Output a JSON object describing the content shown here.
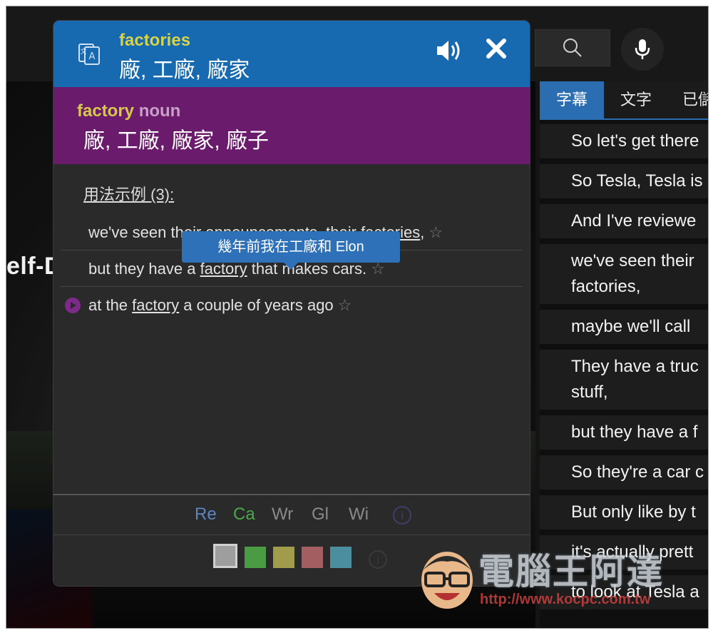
{
  "popup": {
    "headword": "factories",
    "translation": "廠, 工廠, 廠家",
    "pos_word": "factory",
    "pos_label": "noun",
    "pos_translation": "廠, 工廠, 廠家, 廠子",
    "examples_title": "用法示例 (3):",
    "examples": [
      {
        "pre": "we've seen their announcements, their ",
        "word": "factories",
        "post": ","
      },
      {
        "pre": "but they have a ",
        "word": "factory",
        "post": " that makes cars."
      },
      {
        "pre": "at the ",
        "word": "factory",
        "post": " a couple of years ago"
      }
    ],
    "star": "☆",
    "tooltip": "幾年前我在工廠和 Elon",
    "sources": [
      {
        "label": "Re",
        "color": "#5b86c2"
      },
      {
        "label": "Ca",
        "color": "#4aa84a"
      },
      {
        "label": "Wr",
        "color": "#8a8a8a"
      },
      {
        "label": "Gl",
        "color": "#8a8a8a"
      },
      {
        "label": "Wi",
        "color": "#8a8a8a"
      }
    ],
    "info": "i",
    "swatches": [
      "#9e9e9e",
      "#4b9b45",
      "#a09c4c",
      "#a25e60",
      "#4a8ea0"
    ]
  },
  "video": {
    "title_fragment": "elf-Driv"
  },
  "panel": {
    "tabs": [
      "字幕",
      "文字",
      "已儲"
    ],
    "lines": [
      "So let's get there",
      "So Tesla, Tesla is",
      "And I've reviewe",
      "we've seen their\nfactories,",
      "maybe we'll call",
      "They have a truc\nstuff,",
      "but they have a f",
      "So they're a car c",
      "But only like by t",
      "it's actually prett",
      "to look at Tesla a"
    ]
  },
  "watermark": {
    "title": "電腦王阿達",
    "url": "http://www.kocpc.com.tw"
  }
}
